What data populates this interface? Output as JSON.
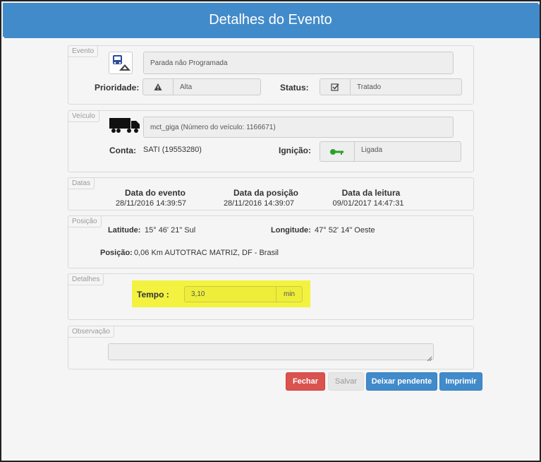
{
  "header": {
    "title": "Detalhes do Evento"
  },
  "evento": {
    "legend": "Evento",
    "icon": "bus-event-icon",
    "tipo_value": "Parada não Programada",
    "prioridade_label": "Prioridade:",
    "prioridade_icon": "warning-icon",
    "prioridade_value": "Alta",
    "status_label": "Status:",
    "status_icon": "checkbox-icon",
    "status_value": "Tratado"
  },
  "veiculo": {
    "legend": "Veículo",
    "icon": "truck-icon",
    "nome_value": "mct_giga (Número do veículo: 1166671)",
    "conta_label": "Conta:",
    "conta_value": "SATI (19553280)",
    "ignicao_label": "Ignição:",
    "ignicao_icon": "key-icon",
    "ignicao_value": "Ligada",
    "key_color": "#2ca02c"
  },
  "datas": {
    "legend": "Datas",
    "evento_label": "Data do evento",
    "evento_value": "28/11/2016 14:39:57",
    "posicao_label": "Data da posição",
    "posicao_value": "28/11/2016 14:39:07",
    "leitura_label": "Data da leitura",
    "leitura_value": "09/01/2017 14:47:31"
  },
  "posicao": {
    "legend": "Posição",
    "latitude_label": "Latitude:",
    "latitude_value": "15° 46' 21\" Sul",
    "longitude_label": "Longitude:",
    "longitude_value": "47° 52' 14\" Oeste",
    "posicao_label": "Posição:",
    "posicao_value": "0,06 Km AUTOTRAC MATRIZ, DF - Brasil"
  },
  "detalhes": {
    "legend": "Detalhes",
    "tempo_label": "Tempo :",
    "tempo_value": "3,10",
    "tempo_unit": "min",
    "highlight_color": "#f3f240"
  },
  "observacao": {
    "legend": "Observação",
    "value": ""
  },
  "buttons": {
    "fechar": "Fechar",
    "salvar": "Salvar",
    "deixar_pendente": "Deixar pendente",
    "imprimir": "Imprimir"
  },
  "colors": {
    "header": "#428bca",
    "fechar": "#d9534f",
    "primary": "#428bca"
  }
}
